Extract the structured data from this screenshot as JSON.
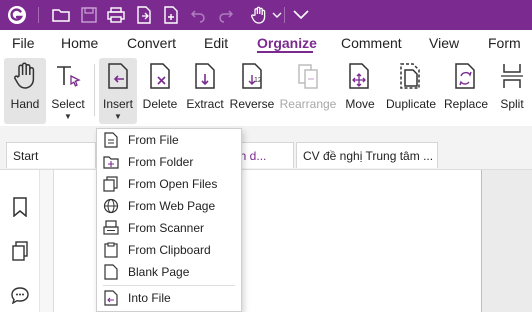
{
  "colors": {
    "brand": "#7b2b8f",
    "disabled": "#a8a8a8"
  },
  "titlebar": {
    "icons": [
      "app-logo-icon",
      "open-folder-icon",
      "save-icon",
      "print-icon",
      "export-icon",
      "new-icon",
      "undo-icon",
      "redo-icon",
      "hand-tool-icon",
      "chevron-down-icon",
      "customize-icon"
    ]
  },
  "menu": [
    {
      "label": "File"
    },
    {
      "label": "Home"
    },
    {
      "label": "Convert"
    },
    {
      "label": "Edit"
    },
    {
      "label": "Organize",
      "active": true
    },
    {
      "label": "Comment"
    },
    {
      "label": "View"
    },
    {
      "label": "Form"
    }
  ],
  "ribbon": {
    "hand": "Hand",
    "select": "Select",
    "insert": "Insert",
    "delete": "Delete",
    "extract": "Extract",
    "reverse": "Reverse",
    "rearrange": "Rearrange",
    "move": "Move",
    "duplicate": "Duplicate",
    "replace": "Replace",
    "split": "Split"
  },
  "doc_tabs": {
    "start": "Start",
    "tab2_partial": "nh d...",
    "tab3": "CV đề nghị Trung tâm ..."
  },
  "insert_menu": {
    "items": [
      {
        "label": "From File",
        "icon": "file-icon"
      },
      {
        "label": "From Folder",
        "icon": "folder-icon"
      },
      {
        "label": "From Open Files",
        "icon": "open-files-icon"
      },
      {
        "label": "From Web Page",
        "icon": "globe-icon"
      },
      {
        "label": "From Scanner",
        "icon": "scanner-icon"
      },
      {
        "label": "From Clipboard",
        "icon": "clipboard-icon"
      },
      {
        "label": "Blank Page",
        "icon": "blank-page-icon"
      },
      {
        "label": "Into File",
        "icon": "into-file-icon"
      }
    ]
  },
  "sidebar": {
    "icons": [
      "bookmark-icon",
      "pages-icon",
      "comments-icon"
    ]
  }
}
